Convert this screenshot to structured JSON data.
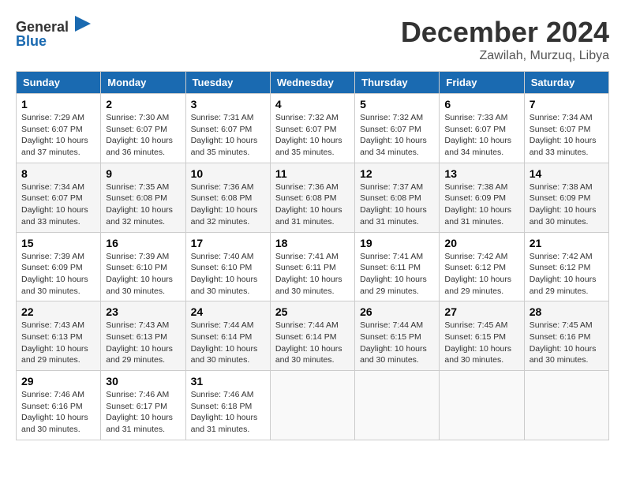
{
  "header": {
    "logo_general": "General",
    "logo_blue": "Blue",
    "month": "December 2024",
    "location": "Zawilah, Murzuq, Libya"
  },
  "days_of_week": [
    "Sunday",
    "Monday",
    "Tuesday",
    "Wednesday",
    "Thursday",
    "Friday",
    "Saturday"
  ],
  "weeks": [
    [
      {
        "day": "1",
        "sunrise": "7:29 AM",
        "sunset": "6:07 PM",
        "daylight": "10 hours and 37 minutes."
      },
      {
        "day": "2",
        "sunrise": "7:30 AM",
        "sunset": "6:07 PM",
        "daylight": "10 hours and 36 minutes."
      },
      {
        "day": "3",
        "sunrise": "7:31 AM",
        "sunset": "6:07 PM",
        "daylight": "10 hours and 35 minutes."
      },
      {
        "day": "4",
        "sunrise": "7:32 AM",
        "sunset": "6:07 PM",
        "daylight": "10 hours and 35 minutes."
      },
      {
        "day": "5",
        "sunrise": "7:32 AM",
        "sunset": "6:07 PM",
        "daylight": "10 hours and 34 minutes."
      },
      {
        "day": "6",
        "sunrise": "7:33 AM",
        "sunset": "6:07 PM",
        "daylight": "10 hours and 34 minutes."
      },
      {
        "day": "7",
        "sunrise": "7:34 AM",
        "sunset": "6:07 PM",
        "daylight": "10 hours and 33 minutes."
      }
    ],
    [
      {
        "day": "8",
        "sunrise": "7:34 AM",
        "sunset": "6:07 PM",
        "daylight": "10 hours and 33 minutes."
      },
      {
        "day": "9",
        "sunrise": "7:35 AM",
        "sunset": "6:08 PM",
        "daylight": "10 hours and 32 minutes."
      },
      {
        "day": "10",
        "sunrise": "7:36 AM",
        "sunset": "6:08 PM",
        "daylight": "10 hours and 32 minutes."
      },
      {
        "day": "11",
        "sunrise": "7:36 AM",
        "sunset": "6:08 PM",
        "daylight": "10 hours and 31 minutes."
      },
      {
        "day": "12",
        "sunrise": "7:37 AM",
        "sunset": "6:08 PM",
        "daylight": "10 hours and 31 minutes."
      },
      {
        "day": "13",
        "sunrise": "7:38 AM",
        "sunset": "6:09 PM",
        "daylight": "10 hours and 31 minutes."
      },
      {
        "day": "14",
        "sunrise": "7:38 AM",
        "sunset": "6:09 PM",
        "daylight": "10 hours and 30 minutes."
      }
    ],
    [
      {
        "day": "15",
        "sunrise": "7:39 AM",
        "sunset": "6:09 PM",
        "daylight": "10 hours and 30 minutes."
      },
      {
        "day": "16",
        "sunrise": "7:39 AM",
        "sunset": "6:10 PM",
        "daylight": "10 hours and 30 minutes."
      },
      {
        "day": "17",
        "sunrise": "7:40 AM",
        "sunset": "6:10 PM",
        "daylight": "10 hours and 30 minutes."
      },
      {
        "day": "18",
        "sunrise": "7:41 AM",
        "sunset": "6:11 PM",
        "daylight": "10 hours and 30 minutes."
      },
      {
        "day": "19",
        "sunrise": "7:41 AM",
        "sunset": "6:11 PM",
        "daylight": "10 hours and 29 minutes."
      },
      {
        "day": "20",
        "sunrise": "7:42 AM",
        "sunset": "6:12 PM",
        "daylight": "10 hours and 29 minutes."
      },
      {
        "day": "21",
        "sunrise": "7:42 AM",
        "sunset": "6:12 PM",
        "daylight": "10 hours and 29 minutes."
      }
    ],
    [
      {
        "day": "22",
        "sunrise": "7:43 AM",
        "sunset": "6:13 PM",
        "daylight": "10 hours and 29 minutes."
      },
      {
        "day": "23",
        "sunrise": "7:43 AM",
        "sunset": "6:13 PM",
        "daylight": "10 hours and 29 minutes."
      },
      {
        "day": "24",
        "sunrise": "7:44 AM",
        "sunset": "6:14 PM",
        "daylight": "10 hours and 30 minutes."
      },
      {
        "day": "25",
        "sunrise": "7:44 AM",
        "sunset": "6:14 PM",
        "daylight": "10 hours and 30 minutes."
      },
      {
        "day": "26",
        "sunrise": "7:44 AM",
        "sunset": "6:15 PM",
        "daylight": "10 hours and 30 minutes."
      },
      {
        "day": "27",
        "sunrise": "7:45 AM",
        "sunset": "6:15 PM",
        "daylight": "10 hours and 30 minutes."
      },
      {
        "day": "28",
        "sunrise": "7:45 AM",
        "sunset": "6:16 PM",
        "daylight": "10 hours and 30 minutes."
      }
    ],
    [
      {
        "day": "29",
        "sunrise": "7:46 AM",
        "sunset": "6:16 PM",
        "daylight": "10 hours and 30 minutes."
      },
      {
        "day": "30",
        "sunrise": "7:46 AM",
        "sunset": "6:17 PM",
        "daylight": "10 hours and 31 minutes."
      },
      {
        "day": "31",
        "sunrise": "7:46 AM",
        "sunset": "6:18 PM",
        "daylight": "10 hours and 31 minutes."
      },
      null,
      null,
      null,
      null
    ]
  ]
}
